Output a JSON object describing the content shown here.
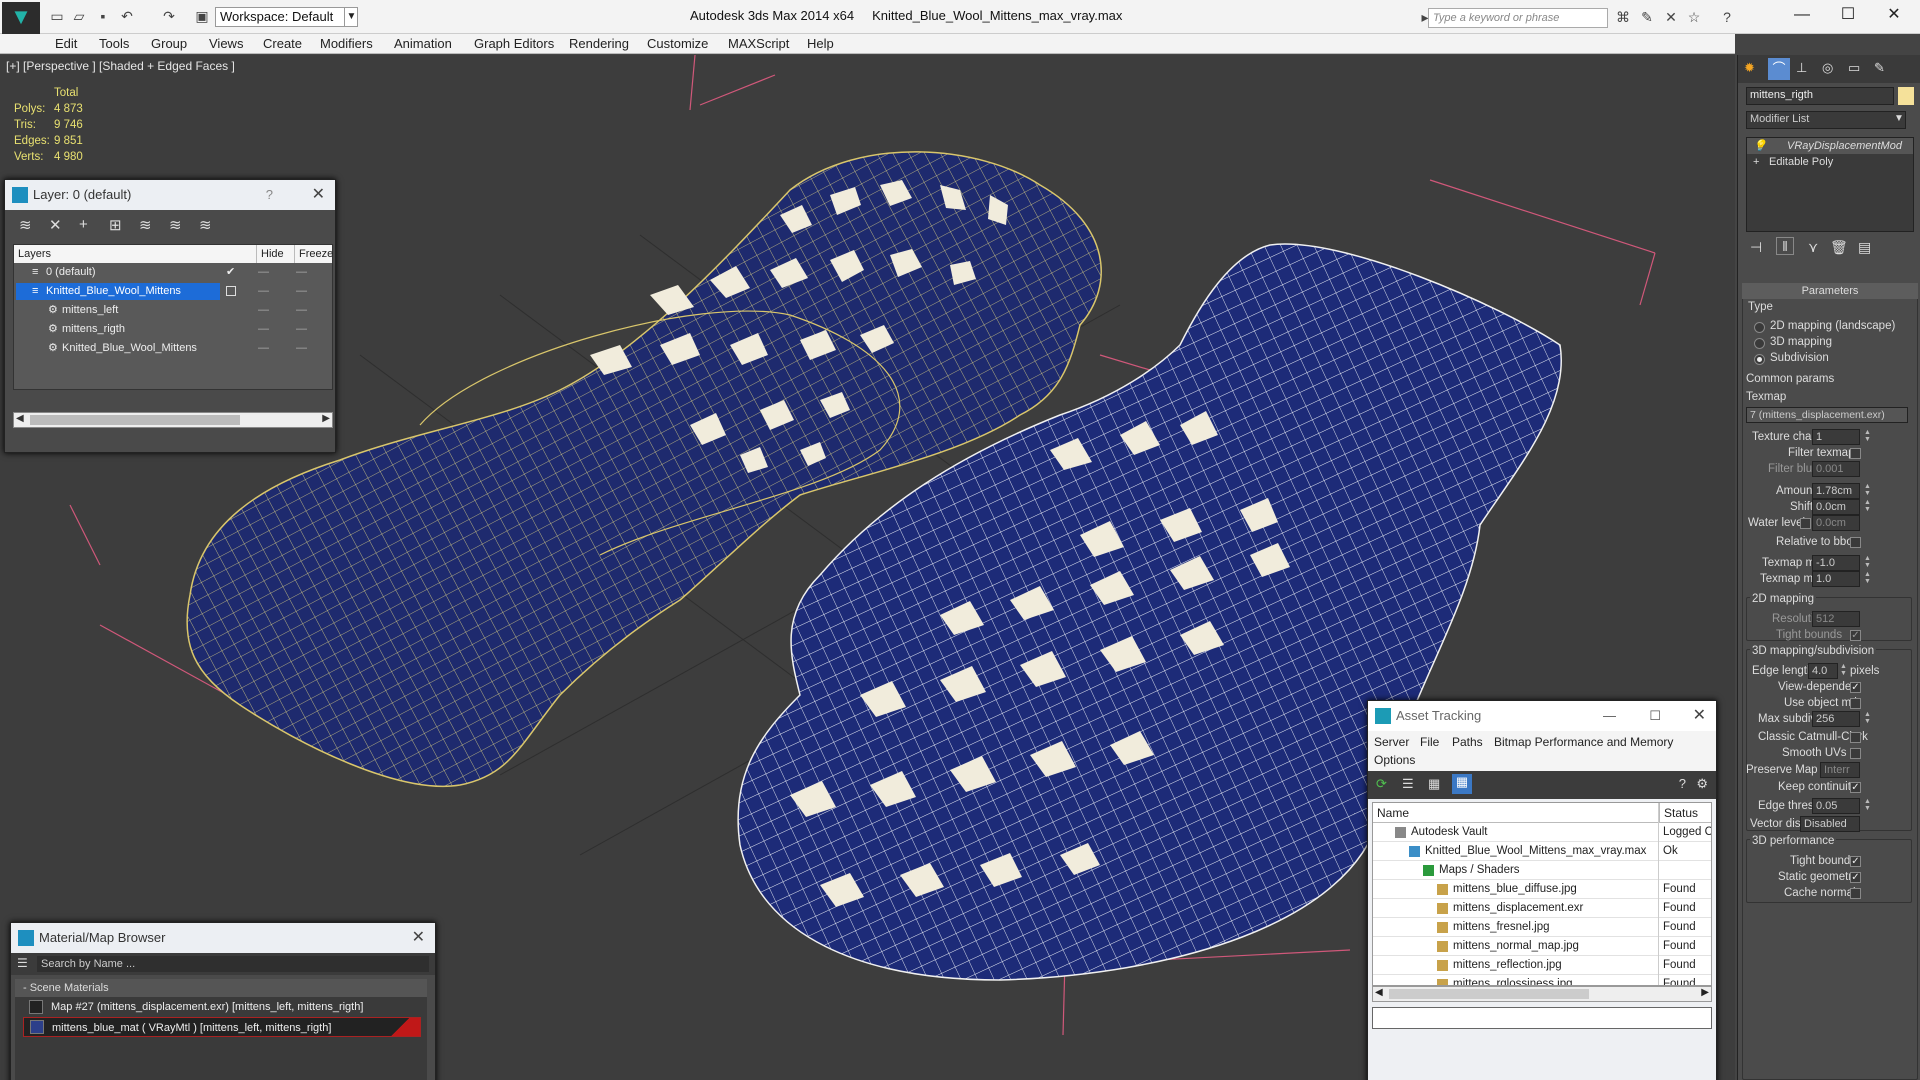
{
  "titlebar": {
    "workspace": "Workspace: Default",
    "app": "Autodesk 3ds Max  2014 x64",
    "file": "Knitted_Blue_Wool_Mittens_max_vray.max",
    "search_placeholder": "Type a keyword or phrase"
  },
  "menu": [
    "Edit",
    "Tools",
    "Group",
    "Views",
    "Create",
    "Modifiers",
    "Animation",
    "Graph Editors",
    "Rendering",
    "Customize",
    "MAXScript",
    "Help"
  ],
  "viewport": {
    "label": "[+] [Perspective ] [Shaded + Edged Faces ]"
  },
  "stats": {
    "header": "Total",
    "rows": [
      {
        "k": "Polys:",
        "v": "4 873"
      },
      {
        "k": "Tris:",
        "v": "9 746"
      },
      {
        "k": "Edges:",
        "v": "9 851"
      },
      {
        "k": "Verts:",
        "v": "4 980"
      }
    ]
  },
  "layer_panel": {
    "title": "Layer: 0 (default)",
    "columns": [
      "Layers",
      "Hide",
      "Freeze"
    ],
    "rows": [
      {
        "name": "0 (default)",
        "indent": 0
      },
      {
        "name": "Knitted_Blue_Wool_Mittens",
        "indent": 0,
        "selected": true
      },
      {
        "name": "mittens_left",
        "indent": 1
      },
      {
        "name": "mittens_rigth",
        "indent": 1
      },
      {
        "name": "Knitted_Blue_Wool_Mittens",
        "indent": 1
      }
    ]
  },
  "material_browser": {
    "title": "Material/Map Browser",
    "search_placeholder": "Search by Name ...",
    "section": "- Scene Materials",
    "items": [
      "Map #27 (mittens_displacement.exr)  [mittens_left, mittens_rigth]",
      "mittens_blue_mat  ( VRayMtl )  [mittens_left, mittens_rigth]"
    ]
  },
  "asset_tracking": {
    "title": "Asset Tracking",
    "menu": [
      "Server",
      "File",
      "Paths",
      "Bitmap Performance and Memory",
      "Options"
    ],
    "columns": [
      "Name",
      "Status"
    ],
    "rows": [
      {
        "name": "Autodesk Vault",
        "status": "Logged C",
        "indent": 1
      },
      {
        "name": "Knitted_Blue_Wool_Mittens_max_vray.max",
        "status": "Ok",
        "indent": 2
      },
      {
        "name": "Maps / Shaders",
        "status": "",
        "indent": 3
      },
      {
        "name": "mittens_blue_diffuse.jpg",
        "status": "Found",
        "indent": 4
      },
      {
        "name": "mittens_displacement.exr",
        "status": "Found",
        "indent": 4
      },
      {
        "name": "mittens_fresnel.jpg",
        "status": "Found",
        "indent": 4
      },
      {
        "name": "mittens_normal_map.jpg",
        "status": "Found",
        "indent": 4
      },
      {
        "name": "mittens_reflection.jpg",
        "status": "Found",
        "indent": 4
      },
      {
        "name": "mittens_rglossiness.jpg",
        "status": "Found",
        "indent": 4
      }
    ]
  },
  "command_panel": {
    "object_name": "mittens_rigth",
    "modifier_list": "Modifier List",
    "stack": [
      "VRayDisplacementMod",
      "Editable Poly"
    ],
    "parameters_title": "Parameters",
    "type_label": "Type",
    "type_options": [
      "2D mapping (landscape)",
      "3D mapping",
      "Subdivision"
    ],
    "common_params": "Common params",
    "texmap_label": "Texmap",
    "texmap_value": "7 (mittens_displacement.exr)",
    "texture_chan_label": "Texture chan",
    "texture_chan": "1",
    "filter_texmap": "Filter texmap",
    "filter_blur_label": "Filter blur",
    "filter_blur": "0.001",
    "amount_label": "Amount",
    "amount": "1.78cm",
    "shift_label": "Shift",
    "shift": "0.0cm",
    "water_label": "Water level",
    "water": "0.0cm",
    "relative_bbox": "Relative to bbox",
    "texmap_min_label": "Texmap min",
    "texmap_min": "-1.0",
    "texmap_max_label": "Texmap max",
    "texmap_max": "1.0",
    "mapping2d": "2D mapping",
    "resolution_label": "Resolution",
    "resolution": "512",
    "tight_bounds": "Tight bounds",
    "mapping3d": "3D mapping/subdivision",
    "edge_length_label": "Edge length",
    "edge_length": "4.0",
    "pixels": "pixels",
    "view_dependent": "View-dependent",
    "use_object_mtl": "Use object mtl",
    "max_subdivs_label": "Max subdivs",
    "max_subdivs": "256",
    "classic_catmull": "Classic Catmull-Clark",
    "smooth_uvs": "Smooth UVs",
    "preserve_map_bnd": "Preserve Map Bnd",
    "preserve_val": "Interr",
    "keep_continuity": "Keep continuity",
    "edge_thresh_label": "Edge thresh",
    "edge_thresh": "0.05",
    "vector_displ_label": "Vector displ",
    "vector_displ": "Disabled",
    "perf": "3D performance",
    "tight_bounds2": "Tight bounds",
    "static_geometry": "Static geometry",
    "cache_normals": "Cache normals"
  }
}
